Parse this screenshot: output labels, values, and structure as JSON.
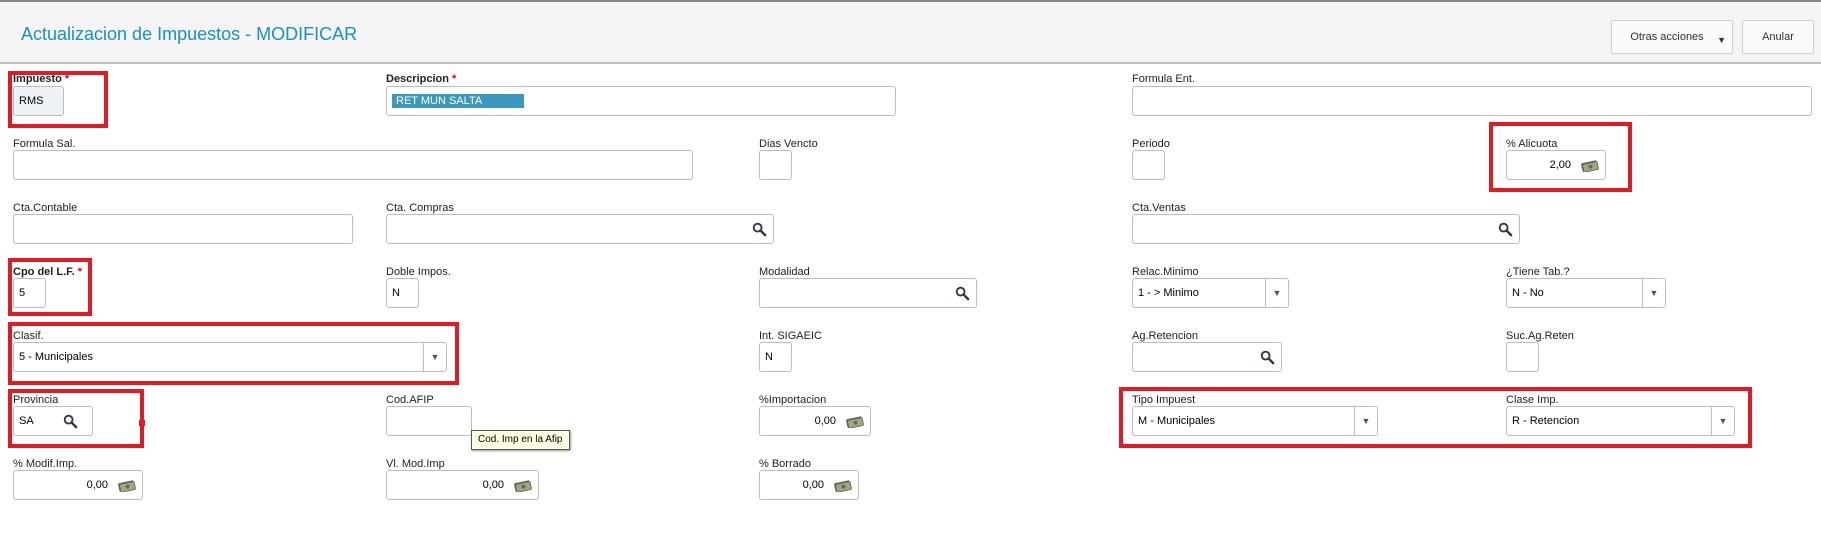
{
  "header": {
    "title": "Actualizacion de Impuestos - MODIFICAR",
    "more_actions": "Otras acciones",
    "cancel": "Anular"
  },
  "fields": {
    "impuesto": {
      "label": "Impuesto",
      "required": "*",
      "value": "RMS"
    },
    "descripcion": {
      "label": "Descripcion",
      "required": "*",
      "value": "RET MUN SALTA"
    },
    "formula_ent": {
      "label": "Formula Ent.",
      "value": ""
    },
    "formula_sal": {
      "label": "Formula Sal.",
      "value": ""
    },
    "dias_vencto": {
      "label": "Dias Vencto",
      "value": ""
    },
    "periodo": {
      "label": "Periodo",
      "value": ""
    },
    "alicuota": {
      "label": "% Alicuota",
      "value": "2,00"
    },
    "cta_contable": {
      "label": "Cta.Contable",
      "value": ""
    },
    "cta_compras": {
      "label": "Cta. Compras",
      "value": ""
    },
    "cta_ventas": {
      "label": "Cta.Ventas",
      "value": ""
    },
    "cpo_lf": {
      "label": "Cpo del L.F.",
      "required": "*",
      "value": "5"
    },
    "doble_impos": {
      "label": "Doble Impos.",
      "value": "N"
    },
    "modalidad": {
      "label": "Modalidad",
      "value": ""
    },
    "relac_minimo": {
      "label": "Relac.Minimo",
      "value": "1 -  > Minimo"
    },
    "tiene_tab": {
      "label": "¿Tiene Tab.?",
      "value": "N -  No"
    },
    "clasif": {
      "label": "Clasif.",
      "value": "5 - Municipales"
    },
    "int_sigaeic": {
      "label": "Int. SIGAEIC",
      "value": "N"
    },
    "ag_retencion": {
      "label": "Ag.Retencion",
      "value": ""
    },
    "suc_ag_reten": {
      "label": "Suc.Ag.Reten",
      "value": ""
    },
    "provincia": {
      "label": "Provincia",
      "value": "SA"
    },
    "cod_afip": {
      "label": "Cod.AFIP",
      "value": "",
      "tooltip": "Cod. Imp en la Afip"
    },
    "importacion": {
      "label": "%Importacion",
      "value": "0,00"
    },
    "tipo_impuest": {
      "label": "Tipo Impuest",
      "value": "M - Municipales"
    },
    "clase_imp": {
      "label": "Clase Imp.",
      "value": "R - Retencion"
    },
    "modif_imp": {
      "label": "% Modif.Imp.",
      "value": "0,00"
    },
    "vl_mod_imp": {
      "label": "Vl. Mod.Imp",
      "value": "0,00"
    },
    "borrado": {
      "label": "% Borrado",
      "value": "0,00"
    }
  },
  "icons": {
    "search": "search-icon",
    "money": "money-icon",
    "dropdown": "chevron-down-icon"
  },
  "colors": {
    "title": "#1a8fc4",
    "highlight": "#e01b24",
    "required": "#d0021b",
    "selection": "#3d98bd"
  }
}
